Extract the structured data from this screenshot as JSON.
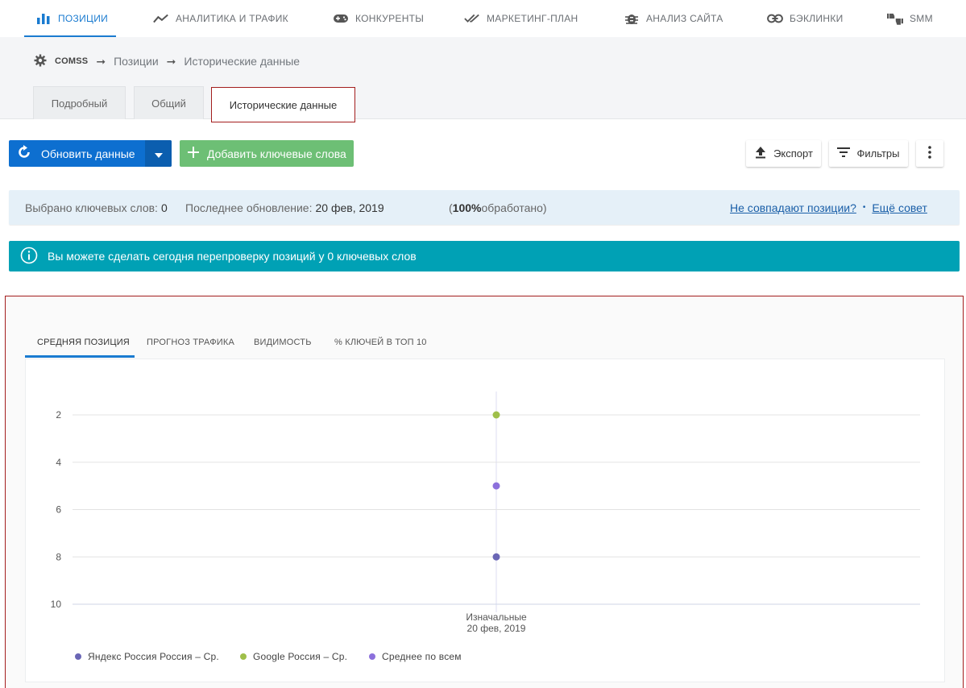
{
  "nav": {
    "items": [
      {
        "label": "ПОЗИЦИИ",
        "icon": "bar-chart-icon"
      },
      {
        "label": "АНАЛИТИКА И ТРАФИК",
        "icon": "trend-line-icon"
      },
      {
        "label": "КОНКУРЕНТЫ",
        "icon": "gamepad-icon"
      },
      {
        "label": "МАРКЕТИНГ-ПЛАН",
        "icon": "double-check-icon"
      },
      {
        "label": "АНАЛИЗ САЙТА",
        "icon": "bug-icon"
      },
      {
        "label": "БЭКЛИНКИ",
        "icon": "link-icon"
      },
      {
        "label": "SMM",
        "icon": "thumbs-icon"
      }
    ],
    "active_index": 0
  },
  "breadcrumb": {
    "project": "COMSS",
    "items": [
      "Позиции",
      "Исторические данные"
    ]
  },
  "tabs": [
    {
      "label": "Подробный"
    },
    {
      "label": "Общий"
    },
    {
      "label": "Исторические данные"
    }
  ],
  "toolbar": {
    "refresh_label": "Обновить данные",
    "add_keywords_label": "Добавить ключевые слова",
    "export_label": "Экспорт",
    "filters_label": "Фильтры"
  },
  "info": {
    "selected_label": "Выбрано ключевых слов:",
    "selected_value": "0",
    "updated_label": "Последнее обновление:",
    "updated_value": "20 фев, 2019",
    "processed_open": "(",
    "processed_value": "100%",
    "processed_rest": " обработано)",
    "mismatch_link": "Не совпадают позиции?",
    "separator": "•",
    "tip_link": "Ещё совет"
  },
  "notice": {
    "text": "Вы можете сделать сегодня перепроверку позиций у 0 ключевых слов"
  },
  "chart_tabs": [
    {
      "label": "СРЕДНЯЯ ПОЗИЦИЯ"
    },
    {
      "label": "ПРОГНОЗ ТРАФИКА"
    },
    {
      "label": "ВИДИМОСТЬ"
    },
    {
      "label": "% КЛЮЧЕЙ В ТОП 10"
    }
  ],
  "chart_data": {
    "type": "scatter",
    "categories": [
      "Изначальные\n20 фев, 2019"
    ],
    "category_lines": [
      "Изначальные",
      "20 фев, 2019"
    ],
    "y_ticks": [
      2,
      4,
      6,
      8,
      10
    ],
    "y_range": [
      1,
      10
    ],
    "y_inverted": true,
    "series": [
      {
        "name": "Яндекс Россия Россия – Ср.",
        "color": "#6a66b5",
        "values": [
          8
        ]
      },
      {
        "name": "Google Россия – Ср.",
        "color": "#9fbf4a",
        "values": [
          2
        ]
      },
      {
        "name": "Среднее по всем",
        "color": "#8c70dc",
        "values": [
          5
        ]
      }
    ],
    "grid": true,
    "legend_position": "bottom-left"
  },
  "colors": {
    "accent": "#1a7bd0",
    "primary_button": "#0d6fd0",
    "green_button": "#6dbf75",
    "notice": "#00a1b5",
    "highlight_border": "#a31d1d"
  }
}
